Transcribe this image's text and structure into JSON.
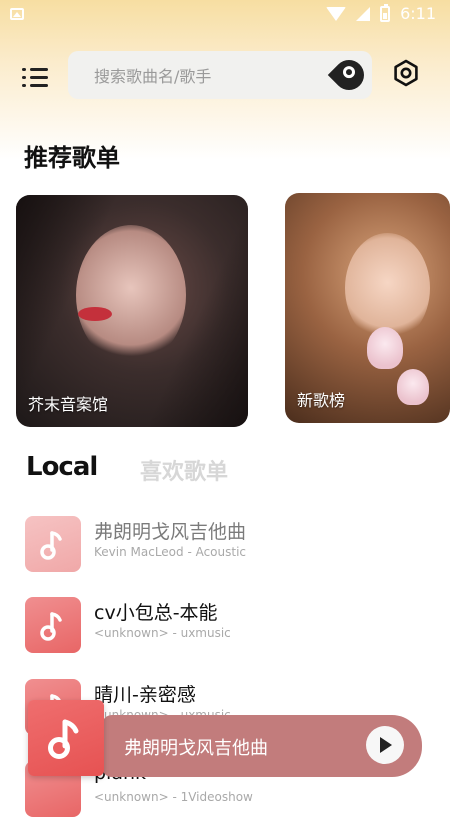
{
  "status_bar": {
    "time": "6:11"
  },
  "header": {
    "search_placeholder": "搜索歌曲名/歌手"
  },
  "section_title": "推荐歌单",
  "playlists": [
    {
      "label": "芥末音案馆"
    },
    {
      "label": "新歌榜"
    }
  ],
  "tabs": {
    "local": "Local",
    "favorites": "喜欢歌单"
  },
  "songs": [
    {
      "title": "弗朗明戈风吉他曲",
      "subtitle": "Kevin MacLeod - Acoustic"
    },
    {
      "title": "cv小包总-本能",
      "subtitle": "<unknown> - uxmusic"
    },
    {
      "title": "晴川-亲密感",
      "subtitle": "<unknown> - uxmusic"
    },
    {
      "title": "plank",
      "subtitle": "<unknown> - 1Videoshow"
    }
  ],
  "player": {
    "title": "弗朗明戈风吉他曲"
  },
  "colors": {
    "accent": "#e86666",
    "player_bar": "#c27c7c",
    "header_gradient": "#f7dea2"
  }
}
